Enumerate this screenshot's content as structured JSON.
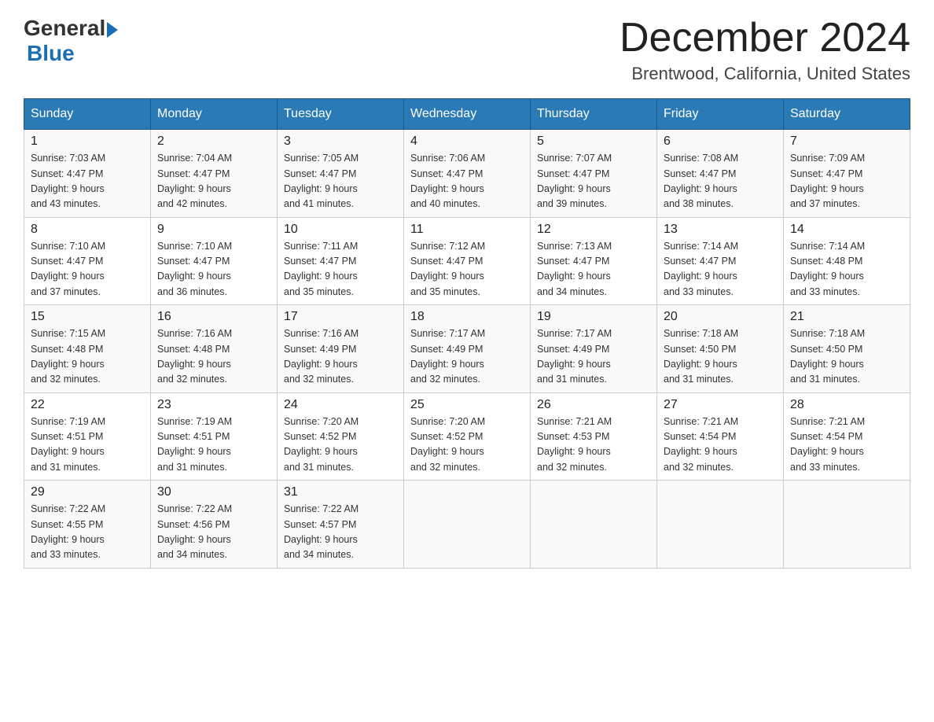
{
  "logo": {
    "general": "General",
    "arrow": "",
    "blue": "Blue"
  },
  "title": "December 2024",
  "subtitle": "Brentwood, California, United States",
  "days_of_week": [
    "Sunday",
    "Monday",
    "Tuesday",
    "Wednesday",
    "Thursday",
    "Friday",
    "Saturday"
  ],
  "weeks": [
    [
      {
        "num": "1",
        "sunrise": "7:03 AM",
        "sunset": "4:47 PM",
        "daylight": "9 hours and 43 minutes."
      },
      {
        "num": "2",
        "sunrise": "7:04 AM",
        "sunset": "4:47 PM",
        "daylight": "9 hours and 42 minutes."
      },
      {
        "num": "3",
        "sunrise": "7:05 AM",
        "sunset": "4:47 PM",
        "daylight": "9 hours and 41 minutes."
      },
      {
        "num": "4",
        "sunrise": "7:06 AM",
        "sunset": "4:47 PM",
        "daylight": "9 hours and 40 minutes."
      },
      {
        "num": "5",
        "sunrise": "7:07 AM",
        "sunset": "4:47 PM",
        "daylight": "9 hours and 39 minutes."
      },
      {
        "num": "6",
        "sunrise": "7:08 AM",
        "sunset": "4:47 PM",
        "daylight": "9 hours and 38 minutes."
      },
      {
        "num": "7",
        "sunrise": "7:09 AM",
        "sunset": "4:47 PM",
        "daylight": "9 hours and 37 minutes."
      }
    ],
    [
      {
        "num": "8",
        "sunrise": "7:10 AM",
        "sunset": "4:47 PM",
        "daylight": "9 hours and 37 minutes."
      },
      {
        "num": "9",
        "sunrise": "7:10 AM",
        "sunset": "4:47 PM",
        "daylight": "9 hours and 36 minutes."
      },
      {
        "num": "10",
        "sunrise": "7:11 AM",
        "sunset": "4:47 PM",
        "daylight": "9 hours and 35 minutes."
      },
      {
        "num": "11",
        "sunrise": "7:12 AM",
        "sunset": "4:47 PM",
        "daylight": "9 hours and 35 minutes."
      },
      {
        "num": "12",
        "sunrise": "7:13 AM",
        "sunset": "4:47 PM",
        "daylight": "9 hours and 34 minutes."
      },
      {
        "num": "13",
        "sunrise": "7:14 AM",
        "sunset": "4:47 PM",
        "daylight": "9 hours and 33 minutes."
      },
      {
        "num": "14",
        "sunrise": "7:14 AM",
        "sunset": "4:48 PM",
        "daylight": "9 hours and 33 minutes."
      }
    ],
    [
      {
        "num": "15",
        "sunrise": "7:15 AM",
        "sunset": "4:48 PM",
        "daylight": "9 hours and 32 minutes."
      },
      {
        "num": "16",
        "sunrise": "7:16 AM",
        "sunset": "4:48 PM",
        "daylight": "9 hours and 32 minutes."
      },
      {
        "num": "17",
        "sunrise": "7:16 AM",
        "sunset": "4:49 PM",
        "daylight": "9 hours and 32 minutes."
      },
      {
        "num": "18",
        "sunrise": "7:17 AM",
        "sunset": "4:49 PM",
        "daylight": "9 hours and 32 minutes."
      },
      {
        "num": "19",
        "sunrise": "7:17 AM",
        "sunset": "4:49 PM",
        "daylight": "9 hours and 31 minutes."
      },
      {
        "num": "20",
        "sunrise": "7:18 AM",
        "sunset": "4:50 PM",
        "daylight": "9 hours and 31 minutes."
      },
      {
        "num": "21",
        "sunrise": "7:18 AM",
        "sunset": "4:50 PM",
        "daylight": "9 hours and 31 minutes."
      }
    ],
    [
      {
        "num": "22",
        "sunrise": "7:19 AM",
        "sunset": "4:51 PM",
        "daylight": "9 hours and 31 minutes."
      },
      {
        "num": "23",
        "sunrise": "7:19 AM",
        "sunset": "4:51 PM",
        "daylight": "9 hours and 31 minutes."
      },
      {
        "num": "24",
        "sunrise": "7:20 AM",
        "sunset": "4:52 PM",
        "daylight": "9 hours and 31 minutes."
      },
      {
        "num": "25",
        "sunrise": "7:20 AM",
        "sunset": "4:52 PM",
        "daylight": "9 hours and 32 minutes."
      },
      {
        "num": "26",
        "sunrise": "7:21 AM",
        "sunset": "4:53 PM",
        "daylight": "9 hours and 32 minutes."
      },
      {
        "num": "27",
        "sunrise": "7:21 AM",
        "sunset": "4:54 PM",
        "daylight": "9 hours and 32 minutes."
      },
      {
        "num": "28",
        "sunrise": "7:21 AM",
        "sunset": "4:54 PM",
        "daylight": "9 hours and 33 minutes."
      }
    ],
    [
      {
        "num": "29",
        "sunrise": "7:22 AM",
        "sunset": "4:55 PM",
        "daylight": "9 hours and 33 minutes."
      },
      {
        "num": "30",
        "sunrise": "7:22 AM",
        "sunset": "4:56 PM",
        "daylight": "9 hours and 34 minutes."
      },
      {
        "num": "31",
        "sunrise": "7:22 AM",
        "sunset": "4:57 PM",
        "daylight": "9 hours and 34 minutes."
      },
      null,
      null,
      null,
      null
    ]
  ],
  "labels": {
    "sunrise": "Sunrise:",
    "sunset": "Sunset:",
    "daylight": "Daylight:"
  },
  "colors": {
    "header_bg": "#2a7ab5",
    "header_text": "#ffffff",
    "border": "#b0c4d8"
  }
}
